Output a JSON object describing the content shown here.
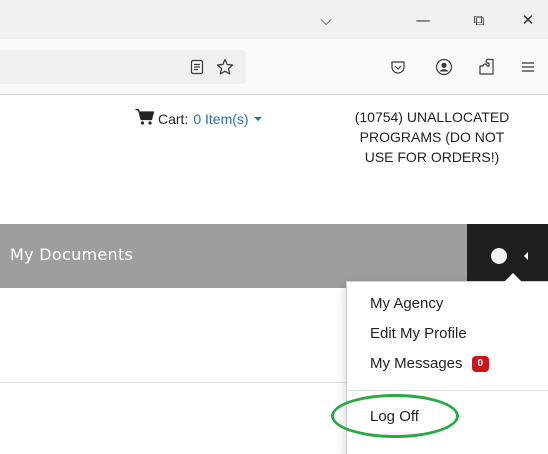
{
  "browser": {
    "titlebar": {
      "chevron_glyph": "⌵",
      "minimize_glyph": "—",
      "restore_glyph": "⧉",
      "close_glyph": "✕"
    },
    "toolbar_icons": [
      "reader-mode-icon",
      "bookmark-star-icon",
      "pocket-icon",
      "account-icon",
      "extensions-icon",
      "menu-icon"
    ]
  },
  "header": {
    "cart_label": "Cart:",
    "cart_link": "0 Item(s)",
    "agency_line1": "(10754) UNALLOCATED",
    "agency_line2": "PROGRAMS (DO NOT",
    "agency_line3": "USE FOR ORDERS!)"
  },
  "nav": {
    "title": "My Documents"
  },
  "user_menu": {
    "items": [
      {
        "label": "My Agency"
      },
      {
        "label": "Edit My Profile"
      },
      {
        "label": "My Messages",
        "badge": "0"
      }
    ],
    "logoff_label": "Log Off"
  },
  "colors": {
    "navbar_bg": "#9e9e9e",
    "userbox_bg": "#1f1f1f",
    "link": "#2a6fb0",
    "badge": "#c9151e",
    "highlight": "#2aa846"
  }
}
